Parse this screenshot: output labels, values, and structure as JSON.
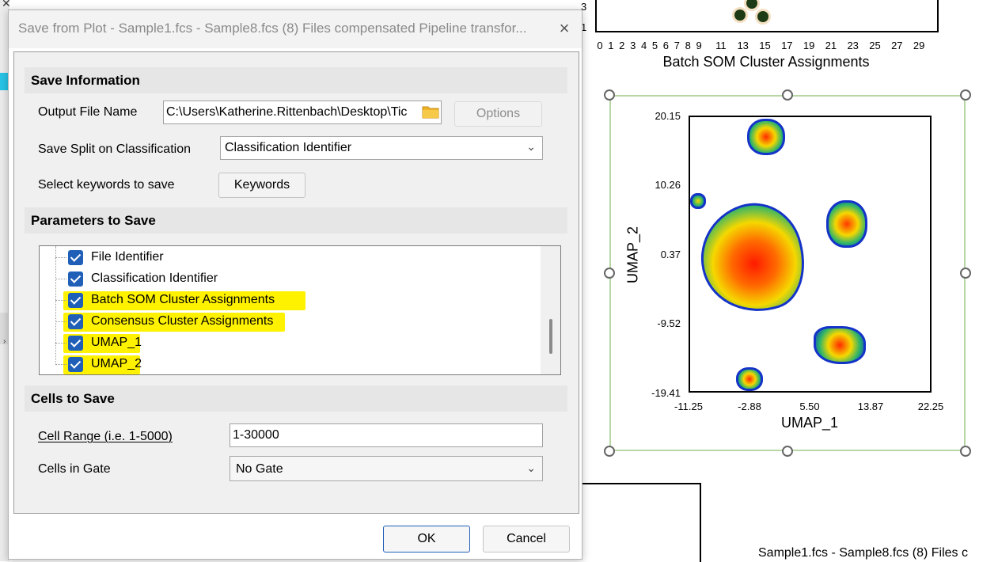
{
  "dialog": {
    "title": "Save from Plot - Sample1.fcs - Sample8.fcs (8) Files compensated Pipeline transfor...",
    "close_icon": "×",
    "sections": {
      "save_information": "Save Information",
      "parameters_to_save": "Parameters to Save",
      "cells_to_save": "Cells to Save"
    },
    "output_file": {
      "label": "Output File Name",
      "value": "C:\\Users\\Katherine.Rittenbach\\Desktop\\Tic",
      "options_button": "Options",
      "folder_icon": "folder-icon"
    },
    "split": {
      "label": "Save Split on Classification",
      "selected": "Classification Identifier"
    },
    "keywords": {
      "label": "Select keywords to save",
      "button": "Keywords"
    },
    "parameters": [
      {
        "label": "File Identifier",
        "checked": true,
        "highlighted": false
      },
      {
        "label": "Classification Identifier",
        "checked": true,
        "highlighted": false
      },
      {
        "label": "Batch SOM Cluster Assignments",
        "checked": true,
        "highlighted": true
      },
      {
        "label": "Consensus Cluster Assignments",
        "checked": true,
        "highlighted": true
      },
      {
        "label": "UMAP_1",
        "checked": true,
        "highlighted": true
      },
      {
        "label": "UMAP_2",
        "checked": true,
        "highlighted": true
      }
    ],
    "cell_range": {
      "label": "Cell Range (i.e. 1-5000)",
      "value": "1-30000"
    },
    "gate": {
      "label": "Cells in Gate",
      "selected": "No Gate"
    },
    "ok_button": "OK",
    "cancel_button": "Cancel"
  },
  "background": {
    "top_plot": {
      "yticks": [
        "3",
        "1"
      ],
      "xticks": [
        "0",
        "1",
        "2",
        "3",
        "4",
        "5",
        "6",
        "7",
        "8",
        "9",
        "11",
        "13",
        "15",
        "17",
        "19",
        "21",
        "23",
        "25",
        "27",
        "29"
      ],
      "xlabel": "Batch SOM Cluster Assignments"
    },
    "umap_plot": {
      "yticks": [
        "20.15",
        "10.26",
        "0.37",
        "-9.52",
        "-19.41"
      ],
      "xticks": [
        "-11.25",
        "-2.88",
        "5.50",
        "13.87",
        "22.25"
      ],
      "xlabel": "UMAP_1",
      "ylabel": "UMAP_2"
    },
    "status_text": "Sample1.fcs - Sample8.fcs (8) Files c"
  },
  "chart_data": {
    "type": "scatter",
    "xlabel": "UMAP_1",
    "ylabel": "UMAP_2",
    "xlim": [
      -11.25,
      22.25
    ],
    "ylim": [
      -19.41,
      20.15
    ],
    "x_ticks": [
      -11.25,
      -2.88,
      5.5,
      13.87,
      22.25
    ],
    "y_ticks": [
      20.15,
      10.26,
      0.37,
      -9.52,
      -19.41
    ]
  }
}
